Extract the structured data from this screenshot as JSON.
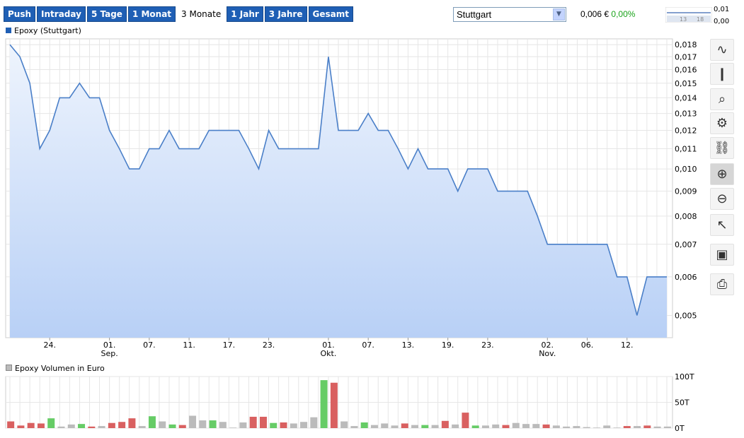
{
  "tabs": [
    "Push",
    "Intraday",
    "5 Tage",
    "1 Monat",
    "3 Monate",
    "1 Jahr",
    "3 Jahre",
    "Gesamt"
  ],
  "active_tab": "3 Monate",
  "exchange_select": "Stuttgart",
  "quote": {
    "price": "0,006 €",
    "change": "0,00%"
  },
  "mini_chart": {
    "max": "0,01",
    "min": "0,00",
    "ticks": [
      "13",
      "18"
    ]
  },
  "legend_price": "Epoxy (Stuttgart)",
  "legend_volume": "Epoxy Volumen in Euro",
  "colors": {
    "tab_bg": "#1f5fb5",
    "line": "#4a7fc8",
    "area_top": "#eef4fd",
    "area_bottom": "#b8d0f6",
    "vol_up": "#66cc66",
    "vol_down": "#d96060",
    "vol_flat": "#bbbbbb",
    "change_text": "#19a319"
  },
  "toolbar": [
    "line-chart-icon",
    "ohlc-icon",
    "indicator-icon",
    "settings-icon",
    "link-icon",
    "zoom-in-icon",
    "zoom-out-icon",
    "pointer-icon",
    "save-icon",
    "print-icon"
  ],
  "chart_data": [
    {
      "type": "area",
      "y_ticks": [
        "0,005",
        "0,006",
        "0,007",
        "0,008",
        "0,009",
        "0,010",
        "0,011",
        "0,012",
        "0,013",
        "0,014",
        "0,015",
        "0,016",
        "0,017",
        "0,018"
      ],
      "scale": "log",
      "ylim": [
        0.0045,
        0.0185
      ],
      "x_ticks": [
        {
          "i": 4,
          "label": "24."
        },
        {
          "i": 10,
          "label": "01.",
          "sub": "Sep."
        },
        {
          "i": 14,
          "label": "07."
        },
        {
          "i": 18,
          "label": "11."
        },
        {
          "i": 22,
          "label": "17."
        },
        {
          "i": 26,
          "label": "23."
        },
        {
          "i": 32,
          "label": "01.",
          "sub": "Okt."
        },
        {
          "i": 36,
          "label": "07."
        },
        {
          "i": 40,
          "label": "13."
        },
        {
          "i": 44,
          "label": "19."
        },
        {
          "i": 48,
          "label": "23."
        },
        {
          "i": 54,
          "label": "02.",
          "sub": "Nov."
        },
        {
          "i": 58,
          "label": "06."
        },
        {
          "i": 62,
          "label": "12."
        }
      ],
      "values": [
        0.018,
        0.017,
        0.015,
        0.011,
        0.012,
        0.014,
        0.014,
        0.015,
        0.014,
        0.014,
        0.012,
        0.011,
        0.01,
        0.01,
        0.011,
        0.011,
        0.012,
        0.011,
        0.011,
        0.011,
        0.012,
        0.012,
        0.012,
        0.012,
        0.011,
        0.01,
        0.012,
        0.011,
        0.011,
        0.011,
        0.011,
        0.011,
        0.017,
        0.012,
        0.012,
        0.012,
        0.013,
        0.012,
        0.012,
        0.011,
        0.01,
        0.011,
        0.01,
        0.01,
        0.01,
        0.009,
        0.01,
        0.01,
        0.01,
        0.009,
        0.009,
        0.009,
        0.009,
        0.008,
        0.007,
        0.007,
        0.007,
        0.007,
        0.007,
        0.007,
        0.007,
        0.006,
        0.006,
        0.005,
        0.006,
        0.006,
        0.006
      ],
      "grid": true
    },
    {
      "type": "bar",
      "y_ticks": [
        "0T",
        "50T",
        "100T"
      ],
      "ylim": [
        0,
        100
      ],
      "values": [
        13,
        5,
        10,
        9,
        19,
        3,
        7,
        8,
        3,
        4,
        10,
        12,
        19,
        4,
        23,
        13,
        7,
        6,
        24,
        15,
        15,
        12,
        1,
        11,
        22,
        22,
        10,
        11,
        9,
        12,
        21,
        93,
        88,
        13,
        4,
        11,
        6,
        9,
        5,
        9,
        6,
        6,
        6,
        14,
        7,
        30,
        5,
        5,
        7,
        6,
        10,
        8,
        8,
        7,
        5,
        3,
        4,
        2,
        1,
        5,
        1,
        4,
        4,
        5,
        3,
        3
      ],
      "directions": [
        "d",
        "d",
        "d",
        "d",
        "u",
        "f",
        "f",
        "u",
        "d",
        "f",
        "d",
        "d",
        "d",
        "f",
        "u",
        "f",
        "u",
        "d",
        "f",
        "f",
        "u",
        "f",
        "f",
        "f",
        "d",
        "d",
        "u",
        "d",
        "f",
        "f",
        "f",
        "u",
        "d",
        "f",
        "f",
        "u",
        "f",
        "f",
        "f",
        "d",
        "f",
        "u",
        "f",
        "d",
        "f",
        "d",
        "u",
        "f",
        "f",
        "d",
        "f",
        "f",
        "f",
        "d",
        "f",
        "f",
        "f",
        "f",
        "f",
        "f",
        "f",
        "d",
        "f",
        "d",
        "f",
        "f"
      ]
    }
  ]
}
